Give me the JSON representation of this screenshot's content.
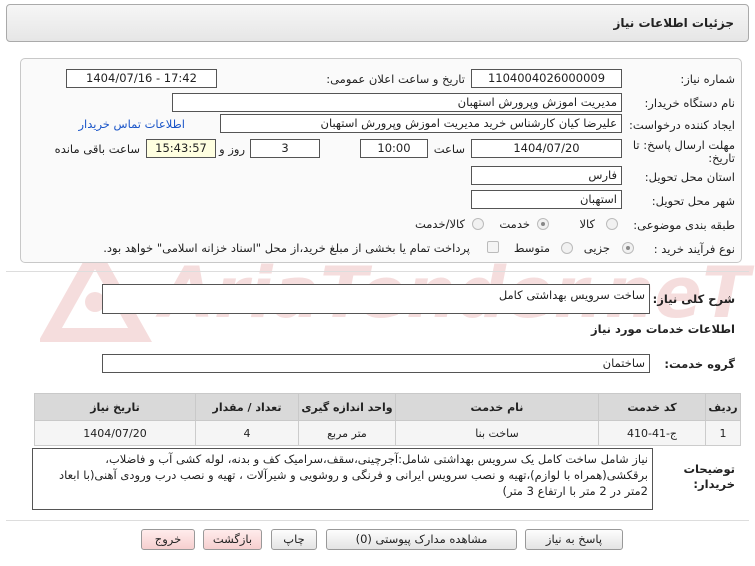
{
  "header": {
    "title": "جزئیات اطلاعات نیاز"
  },
  "form": {
    "need_number_label": "شماره نیاز:",
    "need_number": "1104004026000009",
    "announce_label": "تاریخ و ساعت اعلان عمومی:",
    "announce_value": "1404/07/16 - 17:42",
    "buyer_org_label": "نام دستگاه خریدار:",
    "buyer_org": "مدیریت اموزش وپرورش استهبان",
    "creator_label": "ایجاد کننده درخواست:",
    "creator": "علیرضا کیان کارشناس خرید مدیریت اموزش وپرورش استهبان",
    "contact_link": "اطلاعات تماس خریدار",
    "deadline_label_line1": "مهلت ارسال پاسخ: تا",
    "deadline_label_line2": "تاریخ:",
    "deadline_date": "1404/07/20",
    "time_label": "ساعت",
    "deadline_time": "10:00",
    "days_value": "3",
    "days_label": "روز و",
    "remaining_time": "15:43:57",
    "remaining_label": "ساعت باقی مانده",
    "province_label": "استان محل تحویل:",
    "province": "فارس",
    "city_label": "شهر محل تحویل:",
    "city": "استهبان",
    "category_label": "طبقه بندی موضوعی:",
    "category_options": [
      "کالا",
      "خدمت",
      "کالا/خدمت"
    ],
    "category_selected": "خدمت",
    "process_label": "نوع فرآیند خرید :",
    "process_options": [
      "جزیی",
      "متوسط"
    ],
    "process_selected": "جزیی",
    "payment_note": "پرداخت تمام یا بخشی از مبلغ خرید،از محل \"اسناد خزانه اسلامی\" خواهد بود."
  },
  "need": {
    "summary_label": "شرح کلی نیاز:",
    "summary": "ساخت سرویس بهداشتی کامل",
    "services_heading": "اطلاعات خدمات مورد نیاز",
    "service_group_label": "گروه خدمت:",
    "service_group": "ساختمان"
  },
  "table": {
    "headers": [
      "ردیف",
      "کد خدمت",
      "نام خدمت",
      "واحد اندازه گیری",
      "تعداد / مقدار",
      "تاریخ نیاز"
    ],
    "rows": [
      [
        "1",
        "ج-41-410",
        "ساخت بنا",
        "متر مربع",
        "4",
        "1404/07/20"
      ]
    ]
  },
  "buyer_notes": {
    "label_line1": "توضیحات",
    "label_line2": "خریدار:",
    "text": "نیاز شامل ساخت کامل یک سرویس بهداشتی شامل:آجرچینی،سقف،سرامیک کف و بدنه، لوله کشی آب و فاضلاب، برقکشی(همراه با لوازم)،تهیه و نصب سرویس ایرانی و فرنگی و روشویی و شیرآلات ، تهیه و نصب درب ورودی آهنی(با ابعاد 2متر در 2 متر با ارتفاع 3 متر)"
  },
  "buttons": {
    "reply": "پاسخ به نیاز",
    "attachments": "مشاهده مدارک پیوستی (0)",
    "print": "چاپ",
    "back": "بازگشت",
    "exit": "خروج"
  },
  "watermark": {
    "text": "AriaTender.neT"
  },
  "colors": {
    "link": "#1a55c8",
    "highlight_box": "#ffffe0",
    "header_bg": "#e9e9e9"
  }
}
